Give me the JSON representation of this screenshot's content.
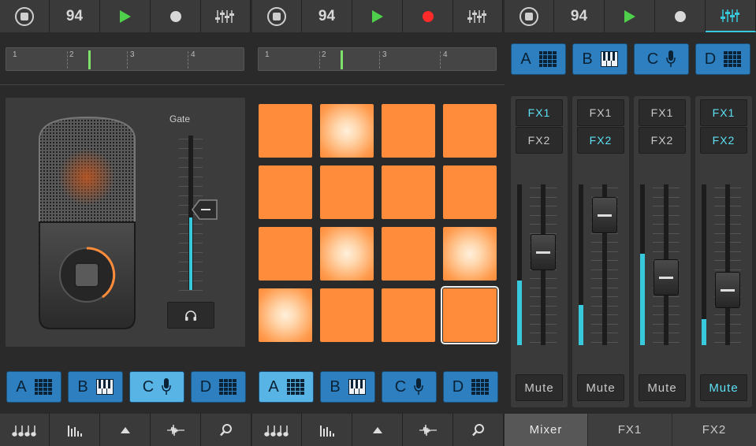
{
  "top_bar": {
    "sections": [
      {
        "tempo": "94",
        "record_active": false,
        "mixer_active": false
      },
      {
        "tempo": "94",
        "record_active": true,
        "mixer_active": false
      },
      {
        "tempo": "94",
        "record_active": false,
        "mixer_active": true
      }
    ]
  },
  "timeline": {
    "bar_numbers": [
      "1",
      "2",
      "3",
      "4"
    ]
  },
  "mic_panel": {
    "gate_label": "Gate",
    "gate_level": 0.52
  },
  "pads": {
    "glowing": [
      1,
      9,
      11,
      12
    ],
    "selected": 15
  },
  "tracks": [
    {
      "letter": "A",
      "icon": "grid-icon"
    },
    {
      "letter": "B",
      "icon": "piano-icon"
    },
    {
      "letter": "C",
      "icon": "mic-icon"
    },
    {
      "letter": "D",
      "icon": "grid-icon"
    }
  ],
  "mixer": {
    "fx1_label": "FX1",
    "fx2_label": "FX2",
    "mute_label": "Mute",
    "strips": [
      {
        "fx1_on": true,
        "fx2_on": false,
        "mute_on": false,
        "meter_level": 0.4,
        "fader_level": 0.6
      },
      {
        "fx1_on": false,
        "fx2_on": true,
        "mute_on": false,
        "meter_level": 0.25,
        "fader_level": 0.9
      },
      {
        "fx1_on": false,
        "fx2_on": false,
        "mute_on": false,
        "meter_level": 0.57,
        "fader_level": 0.4
      },
      {
        "fx1_on": true,
        "fx2_on": true,
        "mute_on": true,
        "meter_level": 0.16,
        "fader_level": 0.3
      }
    ]
  },
  "bottom_tabs": [
    "Mixer",
    "FX1",
    "FX2"
  ],
  "colors": {
    "accent_cyan": "#38c9dc",
    "pad_orange": "#ff8c3a",
    "track_blue": "#2e7fbf",
    "play_green": "#4fd04a",
    "record_red": "#ff2a2a"
  }
}
